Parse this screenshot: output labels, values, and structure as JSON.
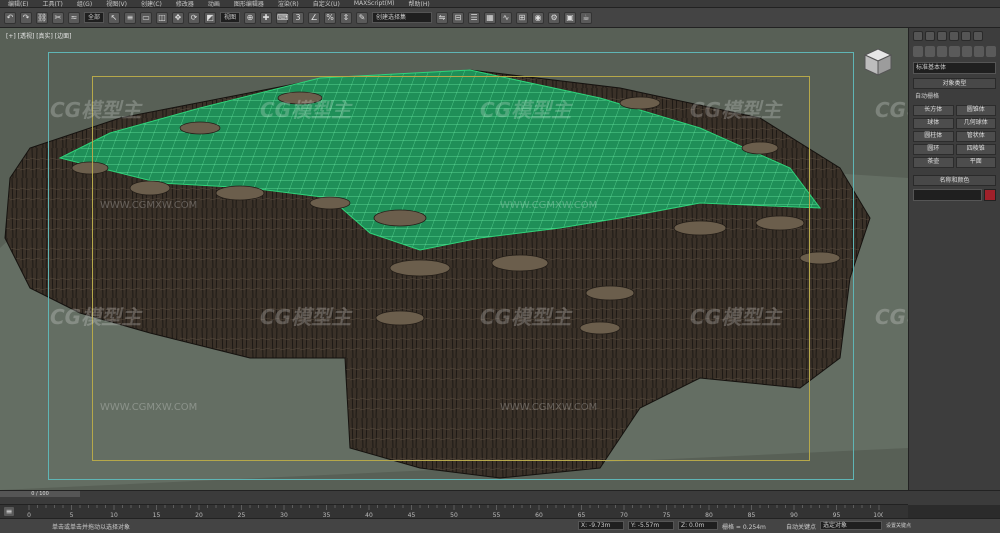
{
  "menu": [
    "编辑(E)",
    "工具(T)",
    "组(G)",
    "视图(V)",
    "创建(C)",
    "修改器",
    "动画",
    "图形编辑器",
    "渲染(R)",
    "自定义(U)",
    "MAXScript(M)",
    "帮助(H)"
  ],
  "toolbar": {
    "selection_filter": "全部",
    "ref_coord": "视图",
    "named_set": "创建选择集"
  },
  "viewport": {
    "label": "[+] [透视] [真实] [边面]",
    "watermark": "CG模型主",
    "watermark_url": "WWW.CGMXW.COM"
  },
  "command_panel": {
    "category": "标准基本体",
    "object_type_title": "对象类型",
    "auto_grid": "自动栅格",
    "buttons": [
      "长方体",
      "圆锥体",
      "球体",
      "几何球体",
      "圆柱体",
      "管状体",
      "圆环",
      "四棱锥",
      "茶壶",
      "平面"
    ],
    "name_color_title": "名称和颜色"
  },
  "timeline": {
    "frame": "0 / 100"
  },
  "trackbar": {
    "ticks": [
      "0",
      "5",
      "10",
      "15",
      "20",
      "25",
      "30",
      "35",
      "40",
      "45",
      "50",
      "55",
      "60",
      "65",
      "70",
      "75",
      "80",
      "85",
      "90",
      "95",
      "100"
    ]
  },
  "status": {
    "prompt": "单击或单击并拖动以选择对象",
    "x": "X: -9.73m",
    "y": "Y: -5.57m",
    "z": "Z: 0.0m",
    "grid": "栅格 = 0.254m",
    "autokey": "自动关键点",
    "selected": "选定对象",
    "setkey": "设置关键点"
  },
  "colors": {
    "viewport_bg": "#586056",
    "terrain_wire": "#2fd37a",
    "rock": "#3a3128",
    "safe_frame": "#5fb5b5",
    "action_frame": "#b6a84a"
  }
}
